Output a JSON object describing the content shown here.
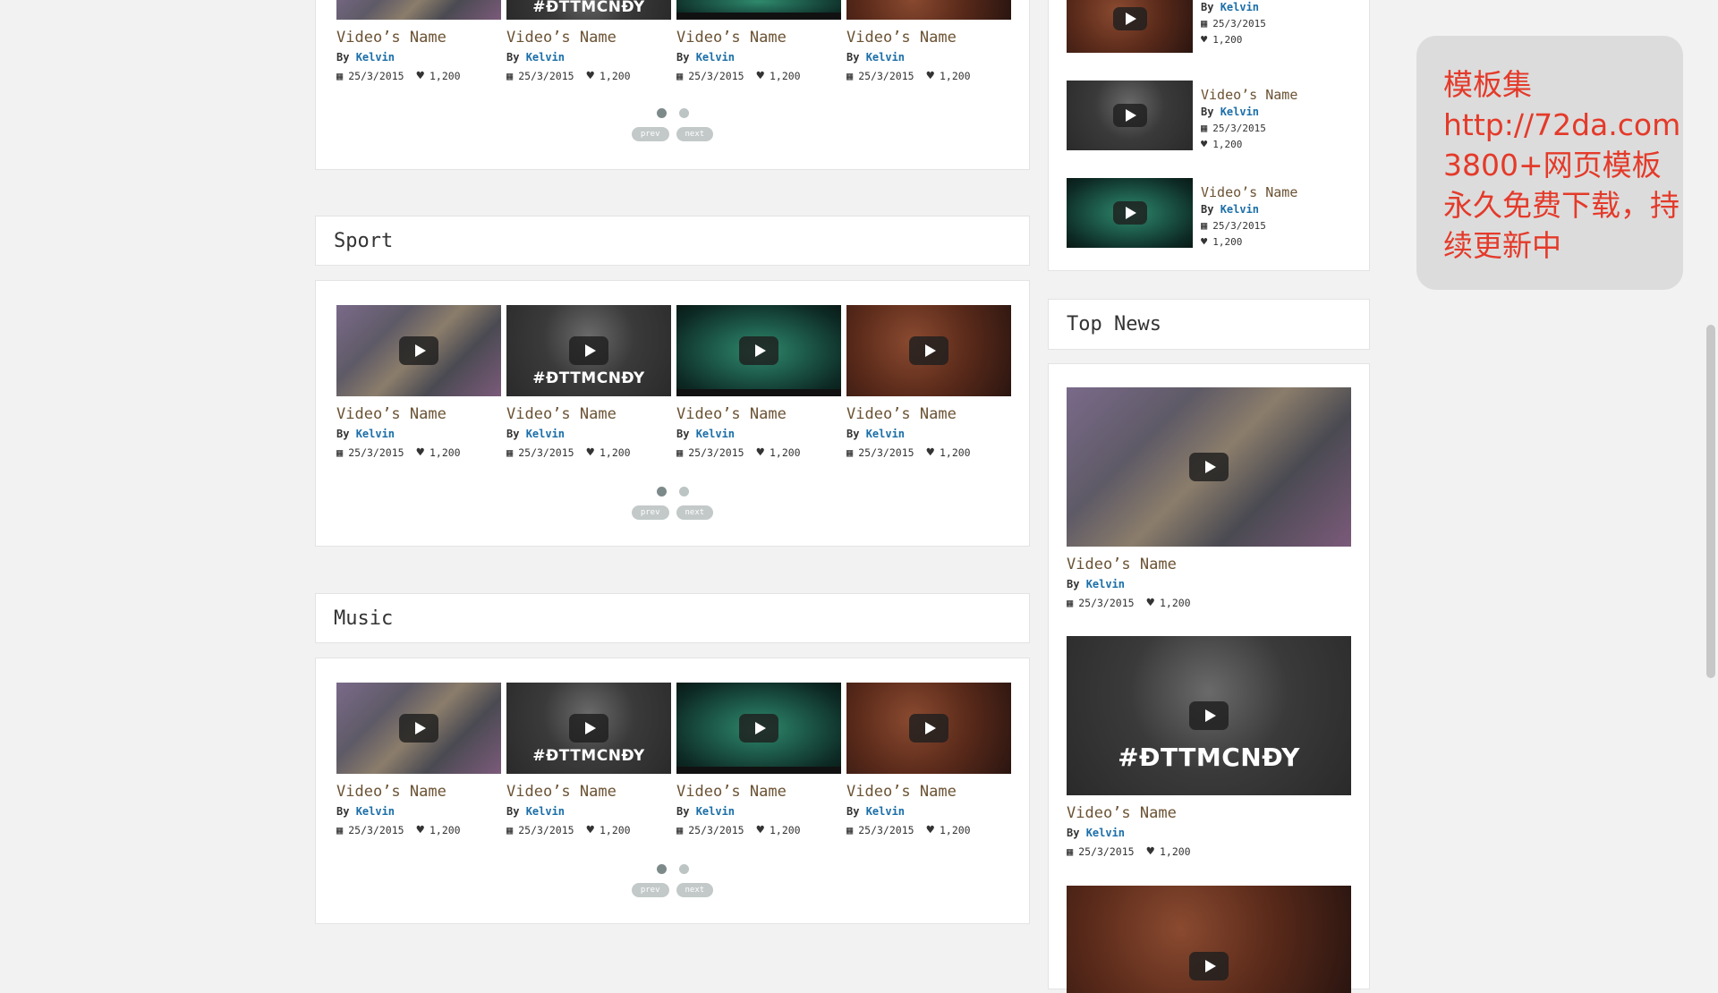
{
  "sections": [
    {
      "title": "",
      "videos": [
        {
          "name": "Video’s Name",
          "by": "By",
          "author": "Kelvin",
          "date": "25/3/2015",
          "likes": "1,200",
          "thumb": "t1",
          "brand": ""
        },
        {
          "name": "Video’s Name",
          "by": "By",
          "author": "Kelvin",
          "date": "25/3/2015",
          "likes": "1,200",
          "thumb": "t2",
          "brand": "#ĐTTMCNĐY"
        },
        {
          "name": "Video’s Name",
          "by": "By",
          "author": "Kelvin",
          "date": "25/3/2015",
          "likes": "1,200",
          "thumb": "t3",
          "brand": ""
        },
        {
          "name": "Video’s Name",
          "by": "By",
          "author": "Kelvin",
          "date": "25/3/2015",
          "likes": "1,200",
          "thumb": "t4",
          "brand": ""
        }
      ],
      "pager": {
        "prev": "prev",
        "next": "next",
        "active_dot": 1,
        "dot_count": 2
      }
    },
    {
      "title": "Sport",
      "videos": [
        {
          "name": "Video’s Name",
          "by": "By",
          "author": "Kelvin",
          "date": "25/3/2015",
          "likes": "1,200",
          "thumb": "t1",
          "brand": ""
        },
        {
          "name": "Video’s Name",
          "by": "By",
          "author": "Kelvin",
          "date": "25/3/2015",
          "likes": "1,200",
          "thumb": "t2",
          "brand": "#ĐTTMCNĐY"
        },
        {
          "name": "Video’s Name",
          "by": "By",
          "author": "Kelvin",
          "date": "25/3/2015",
          "likes": "1,200",
          "thumb": "t3",
          "brand": ""
        },
        {
          "name": "Video’s Name",
          "by": "By",
          "author": "Kelvin",
          "date": "25/3/2015",
          "likes": "1,200",
          "thumb": "t4",
          "brand": ""
        }
      ],
      "pager": {
        "prev": "prev",
        "next": "next",
        "active_dot": 1,
        "dot_count": 2
      }
    },
    {
      "title": "Music",
      "videos": [
        {
          "name": "Video’s Name",
          "by": "By",
          "author": "Kelvin",
          "date": "25/3/2015",
          "likes": "1,200",
          "thumb": "t1",
          "brand": ""
        },
        {
          "name": "Video’s Name",
          "by": "By",
          "author": "Kelvin",
          "date": "25/3/2015",
          "likes": "1,200",
          "thumb": "t2",
          "brand": "#ĐTTMCNĐY"
        },
        {
          "name": "Video’s Name",
          "by": "By",
          "author": "Kelvin",
          "date": "25/3/2015",
          "likes": "1,200",
          "thumb": "t3",
          "brand": ""
        },
        {
          "name": "Video’s Name",
          "by": "By",
          "author": "Kelvin",
          "date": "25/3/2015",
          "likes": "1,200",
          "thumb": "t4",
          "brand": ""
        }
      ],
      "pager": {
        "prev": "prev",
        "next": "next",
        "active_dot": 1,
        "dot_count": 2
      }
    }
  ],
  "sidebar": {
    "list": [
      {
        "name": "",
        "by": "By",
        "author": "Kelvin",
        "date": "25/3/2015",
        "likes": "1,200",
        "thumb": "t4"
      },
      {
        "name": "Video’s Name",
        "by": "By",
        "author": "Kelvin",
        "date": "25/3/2015",
        "likes": "1,200",
        "thumb": "t2"
      },
      {
        "name": "Video’s Name",
        "by": "By",
        "author": "Kelvin",
        "date": "25/3/2015",
        "likes": "1,200",
        "thumb": "t3"
      }
    ],
    "top_news": {
      "title": "Top News",
      "items": [
        {
          "name": "Video’s Name",
          "by": "By",
          "author": "Kelvin",
          "date": "25/3/2015",
          "likes": "1,200",
          "thumb": "t1",
          "brand": ""
        },
        {
          "name": "Video’s Name",
          "by": "By",
          "author": "Kelvin",
          "date": "25/3/2015",
          "likes": "1,200",
          "thumb": "t2",
          "brand": "#ĐTTMCNĐY"
        },
        {
          "name": "",
          "by": "",
          "author": "",
          "date": "",
          "likes": "",
          "thumb": "t4",
          "brand": ""
        }
      ]
    }
  },
  "ad": {
    "text": "模板集\nhttp://72da.com\n3800+网页模板永久免费下载，持续更新中",
    "color": "#e43a2a"
  },
  "icons": {
    "calendar": "calendar-icon",
    "heart": "heart-icon",
    "play": "play-icon"
  },
  "colors": {
    "author": "#1b6ea8",
    "video_name": "#6b5233",
    "dot_active": "#7d8a8a",
    "dot_inactive": "#bcc4c4"
  }
}
